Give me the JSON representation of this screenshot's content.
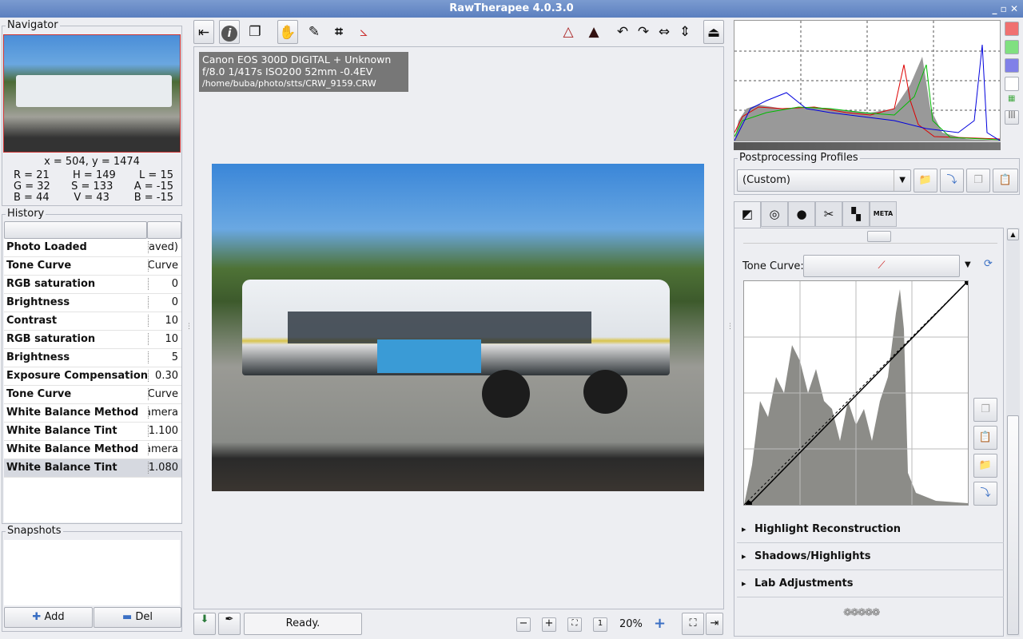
{
  "window": {
    "title": "RawTherapee 4.0.3.0"
  },
  "navigator": {
    "label": "Navigator",
    "coords": "x = 504, y = 1474",
    "values": [
      [
        "R = 21",
        "H = 149",
        "L = 15"
      ],
      [
        "G = 32",
        "S = 133",
        "A = -15"
      ],
      [
        "B = 44",
        "V = 43",
        "B = -15"
      ]
    ]
  },
  "history": {
    "label": "History",
    "items": [
      {
        "name": "Photo Loaded",
        "value": "(Saved)"
      },
      {
        "name": "Tone Curve",
        "value": "Curve"
      },
      {
        "name": "RGB saturation",
        "value": "0"
      },
      {
        "name": "Brightness",
        "value": "0"
      },
      {
        "name": "Contrast",
        "value": "10"
      },
      {
        "name": "RGB saturation",
        "value": "10"
      },
      {
        "name": "Brightness",
        "value": "5"
      },
      {
        "name": "Exposure Compensation",
        "value": "0.30"
      },
      {
        "name": "Tone Curve",
        "value": "Curve"
      },
      {
        "name": "White Balance Method",
        "value": "Camera"
      },
      {
        "name": "White Balance Tint",
        "value": "1.100"
      },
      {
        "name": "White Balance Method",
        "value": "Camera"
      },
      {
        "name": "White Balance Tint",
        "value": "1.080"
      }
    ]
  },
  "snapshots": {
    "label": "Snapshots",
    "add": "Add",
    "del": "Del"
  },
  "info": {
    "camera": "Canon EOS 300D DIGITAL + Unknown",
    "exposure": "f/8.0  1/417s  ISO200  52mm  -0.4EV",
    "path": "/home/buba/photo/stts/CRW_9159.CRW"
  },
  "status": {
    "text": "Ready.",
    "zoom": "20%"
  },
  "profiles": {
    "label": "Postprocessing Profiles",
    "selected": "(Custom)"
  },
  "tonecurve": {
    "label": "Tone Curve:"
  },
  "sections": [
    "Highlight Reconstruction",
    "Shadows/Highlights",
    "Lab Adjustments"
  ],
  "tabs": [
    "exposure",
    "detail",
    "color",
    "transform",
    "raw",
    "metadata"
  ],
  "tabs_meta": "META",
  "colors": {
    "accent": "#5b7fbf",
    "histogram_fill": "#8c8c88"
  }
}
